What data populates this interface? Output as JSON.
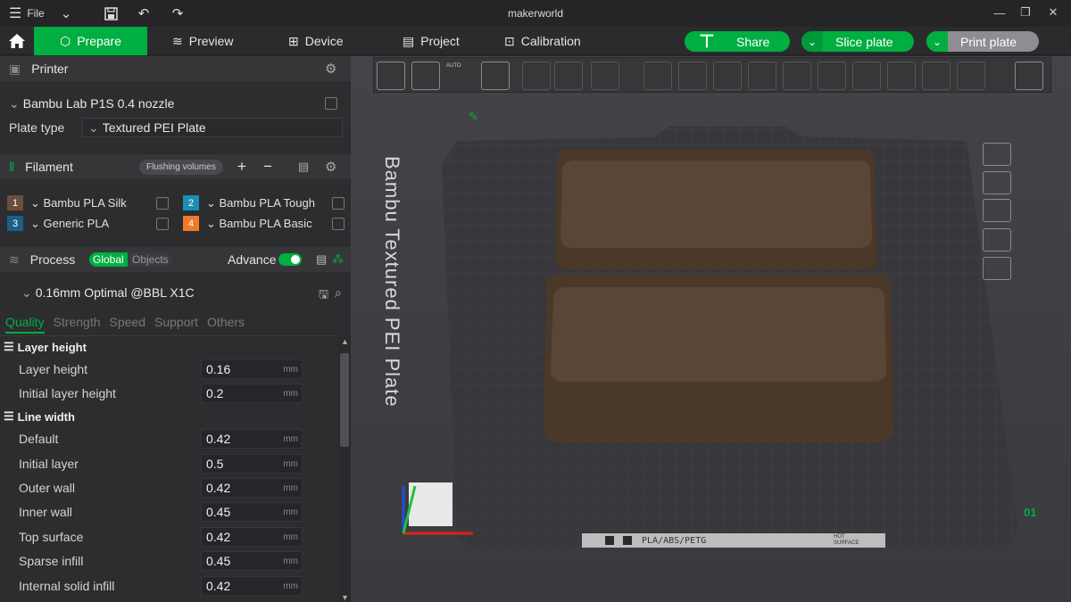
{
  "titlebar": {
    "file_label": "File",
    "app_title": "makerworld"
  },
  "nav": {
    "tabs": [
      {
        "label": "Prepare"
      },
      {
        "label": "Preview"
      },
      {
        "label": "Device"
      },
      {
        "label": "Project"
      },
      {
        "label": "Calibration"
      }
    ],
    "share_label": "Share",
    "slice_label": "Slice plate",
    "print_label": "Print plate"
  },
  "printer": {
    "title": "Printer",
    "model": "Bambu Lab P1S 0.4 nozzle",
    "plate_type_label": "Plate type",
    "plate_type": "Textured PEI Plate"
  },
  "filament": {
    "title": "Filament",
    "flush_label": "Flushing volumes",
    "items": [
      {
        "num": "1",
        "name": "Bambu PLA Silk",
        "color": "#6b4e3d"
      },
      {
        "num": "2",
        "name": "Bambu PLA Tough",
        "color": "#1a8fb5"
      },
      {
        "num": "3",
        "name": "Generic PLA",
        "color": "#1a5f8a"
      },
      {
        "num": "4",
        "name": "Bambu PLA Basic",
        "color": "#f07a2a"
      }
    ]
  },
  "process": {
    "title": "Process",
    "global_label": "Global",
    "objects_label": "Objects",
    "advance_label": "Advance",
    "profile": "0.16mm Optimal @BBL X1C",
    "tabs": [
      "Quality",
      "Strength",
      "Speed",
      "Support",
      "Others"
    ],
    "layer_height_group": "Layer height",
    "line_width_group": "Line width",
    "params": [
      {
        "label": "Layer height",
        "value": "0.16",
        "unit": "mm"
      },
      {
        "label": "Initial layer height",
        "value": "0.2",
        "unit": "mm"
      },
      {
        "label": "Default",
        "value": "0.42",
        "unit": "mm"
      },
      {
        "label": "Initial layer",
        "value": "0.5",
        "unit": "mm"
      },
      {
        "label": "Outer wall",
        "value": "0.42",
        "unit": "mm"
      },
      {
        "label": "Inner wall",
        "value": "0.45",
        "unit": "mm"
      },
      {
        "label": "Top surface",
        "value": "0.42",
        "unit": "mm"
      },
      {
        "label": "Sparse infill",
        "value": "0.45",
        "unit": "mm"
      },
      {
        "label": "Internal solid infill",
        "value": "0.42",
        "unit": "mm"
      }
    ]
  },
  "plate": {
    "name": "Bambu Textured PEI Plate",
    "number": "01",
    "material_label": "PLA/ABS/PETG",
    "hot_label": "HOT",
    "surface_label": "SURFACE",
    "auto_label": "AUTO"
  },
  "colors": {
    "accent": "#00ae42",
    "object": "#5a4636",
    "plate": "#35353a"
  }
}
